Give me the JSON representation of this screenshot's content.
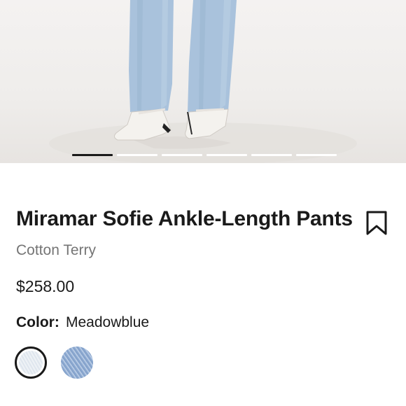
{
  "product": {
    "title": "Miramar Sofie Ankle-Length Pants",
    "material": "Cotton Terry",
    "price": "$258.00",
    "color_label": "Color:",
    "color_value": "Meadowblue"
  },
  "carousel": {
    "slide_count": 6,
    "active_index": 0
  },
  "swatches": [
    {
      "name": "Light wash",
      "selected": true,
      "color": "#e6ecf2"
    },
    {
      "name": "Meadowblue",
      "selected": false,
      "color": "#9cb6da"
    }
  ],
  "icons": {
    "bookmark": "bookmark-icon"
  }
}
